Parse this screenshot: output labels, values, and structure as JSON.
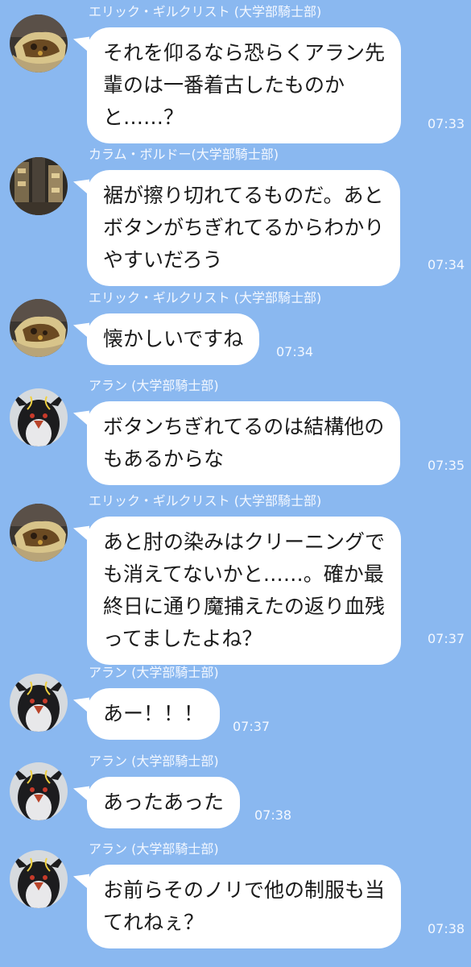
{
  "messages": [
    {
      "sender": "エリック・ギルクリスト (大学部騎士部)",
      "avatar_icon": "food-avatar-icon",
      "text": "それを仰るなら恐らくアラン先\n輩のは一番着古したものか\nと……？",
      "time": "07:33"
    },
    {
      "sender": "カラム・ボルドー(大学部騎士部)",
      "avatar_icon": "building-avatar-icon",
      "text": "裾が擦り切れてるものだ。あと\nボタンがちぎれてるからわかり\nやすいだろう",
      "time": "07:34"
    },
    {
      "sender": "エリック・ギルクリスト (大学部騎士部)",
      "avatar_icon": "food-avatar-icon",
      "text": "懐かしいですね",
      "time": "07:34"
    },
    {
      "sender": "アラン (大学部騎士部)",
      "avatar_icon": "penguin-avatar-icon",
      "text": "ボタンちぎれてるのは結構他の\nもあるからな",
      "time": "07:35"
    },
    {
      "sender": "エリック・ギルクリスト (大学部騎士部)",
      "avatar_icon": "food-avatar-icon",
      "text": "あと肘の染みはクリーニングで\nも消えてないかと……。確か最\n終日に通り魔捕えたの返り血残\nってましたよね？",
      "time": "07:37"
    },
    {
      "sender": "アラン (大学部騎士部)",
      "avatar_icon": "penguin-avatar-icon",
      "text": "あー！！！",
      "time": "07:37"
    },
    {
      "sender": "アラン (大学部騎士部)",
      "avatar_icon": "penguin-avatar-icon",
      "text": "あったあった",
      "time": "07:38"
    },
    {
      "sender": "アラン (大学部騎士部)",
      "avatar_icon": "penguin-avatar-icon",
      "text": "お前らそのノリで他の制服も当\nてれねぇ？",
      "time": "07:38"
    }
  ],
  "colors": {
    "background": "#8ab8f0",
    "bubble": "#ffffff",
    "meta_text": "#f4f8ff"
  }
}
